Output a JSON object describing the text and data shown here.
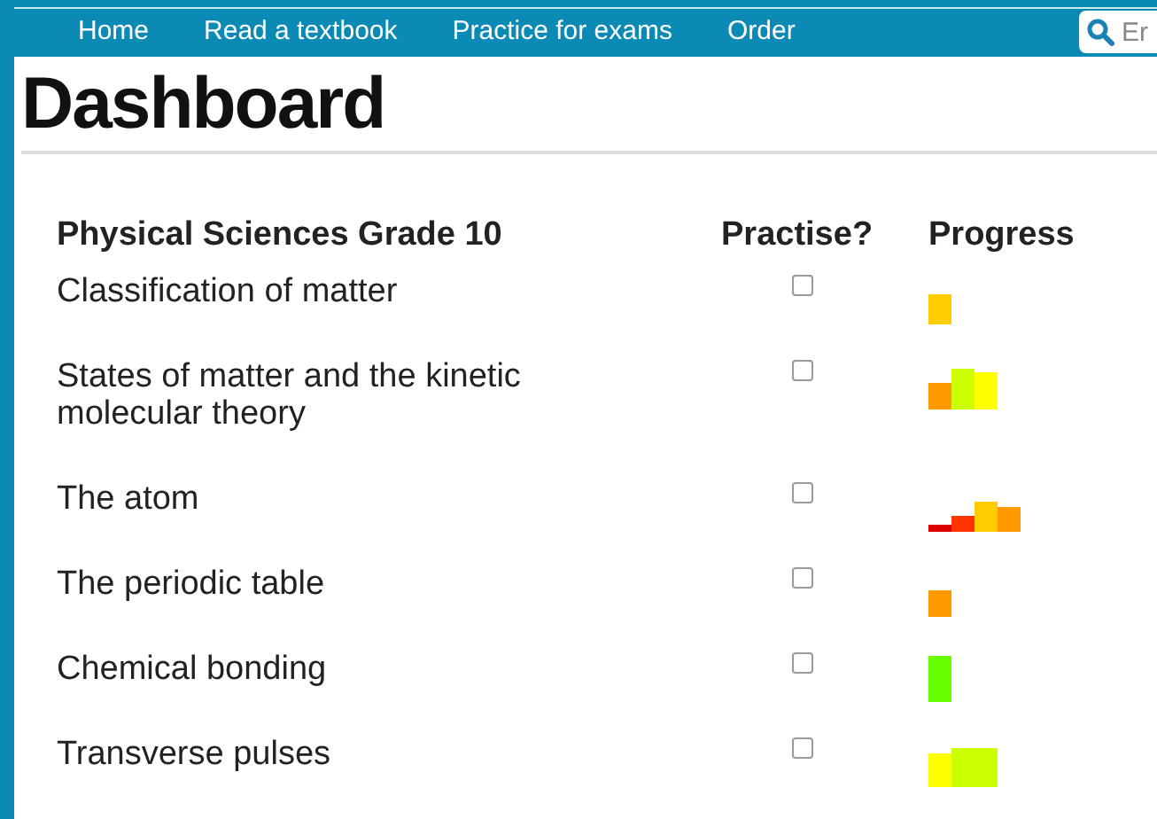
{
  "nav": {
    "items": [
      {
        "label": "Home"
      },
      {
        "label": "Read a textbook"
      },
      {
        "label": "Practice for exams"
      },
      {
        "label": "Order"
      }
    ],
    "search": {
      "placeholder": "Er"
    }
  },
  "page": {
    "title": "Dashboard"
  },
  "table": {
    "columns": [
      "Physical Sciences Grade 10",
      "Practise?",
      "Progress"
    ],
    "rows": [
      {
        "name": "Classification of matter",
        "checked": false
      },
      {
        "name": "States of matter and the kinetic molecular theory",
        "checked": false
      },
      {
        "name": "The atom",
        "checked": false
      },
      {
        "name": "The periodic table",
        "checked": false
      },
      {
        "name": "Chemical bonding",
        "checked": false
      },
      {
        "name": "Transverse pulses",
        "checked": false
      }
    ]
  }
}
